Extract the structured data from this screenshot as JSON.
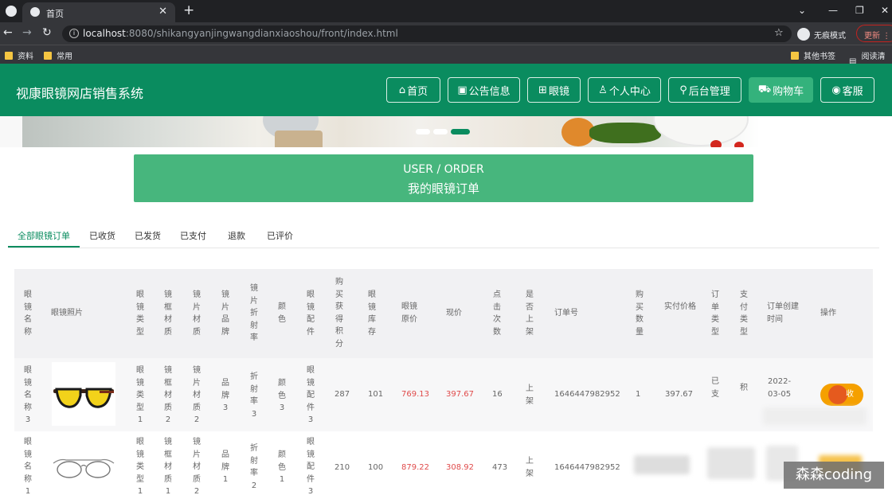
{
  "browser": {
    "tab_title": "首页",
    "url_host": "localhost",
    "url_path": ":8080/shikangyanjingwangdianxiaoshou/front/index.html",
    "incognito_label": "无痕模式",
    "update_label": "更新",
    "bookmarks": [
      "资料",
      "常用"
    ],
    "bookmarks_right": [
      "其他书签",
      "阅读清单"
    ]
  },
  "site": {
    "title": "视康眼镜网店销售系统",
    "nav": [
      {
        "label": "首页",
        "icon": "home-icon"
      },
      {
        "label": "公告信息",
        "icon": "gift-icon"
      },
      {
        "label": "眼镜",
        "icon": "grid-icon"
      },
      {
        "label": "个人中心",
        "icon": "user-icon"
      },
      {
        "label": "后台管理",
        "icon": "link-icon"
      },
      {
        "label": "购物车",
        "icon": "cart-icon"
      },
      {
        "label": "客服",
        "icon": "chat-icon"
      }
    ]
  },
  "order_box": {
    "en": "USER / ORDER",
    "cn": "我的眼镜订单"
  },
  "tabs": [
    "全部眼镜订单",
    "已收货",
    "已发货",
    "已支付",
    "退款",
    "已评价"
  ],
  "table": {
    "headers": [
      "眼镜名称",
      "眼镜照片",
      "眼镜类型",
      "镜框材质",
      "镜片材质",
      "镜片品牌",
      "镜片折射率",
      "颜色",
      "眼镜配件",
      "购买获得积分",
      "眼镜库存",
      "眼镜原价",
      "现价",
      "点击次数",
      "是否上架",
      "订单号",
      "购买数量",
      "实付价格",
      "订单类型",
      "支付类型",
      "订单创建时间",
      "操作"
    ],
    "rows": [
      {
        "name": "眼镜名称3",
        "type": "眼镜类型1",
        "frame": "镜框材质2",
        "lens": "镜片材质2",
        "brand": "品牌3",
        "refraction": "折射率3",
        "color": "颜色3",
        "accessory": "眼镜配件3",
        "points": "287",
        "stock": "101",
        "orig_price": "769.13",
        "price": "397.67",
        "clicks": "16",
        "listed": "上架",
        "order_no": "1646447982952",
        "qty": "1",
        "paid": "397.67",
        "order_type": "已支",
        "pay_type": "积",
        "created": "2022-03-05"
      },
      {
        "name": "眼镜名称1",
        "type": "眼镜类型1",
        "frame": "镜框材质1",
        "lens": "镜片材质2",
        "brand": "品牌1",
        "refraction": "折射率2",
        "color": "颜色1",
        "accessory": "眼镜配件3",
        "points": "210",
        "stock": "100",
        "orig_price": "879.22",
        "price": "308.92",
        "clicks": "473",
        "listed": "上架",
        "order_no": "1646447982952"
      }
    ],
    "op_label": "收"
  },
  "watermark": "森森coding",
  "colors": {
    "brand_green": "#0a8c5f",
    "order_green": "#47b67d",
    "price_red": "#e04b4b",
    "op_orange": "#f5a000"
  }
}
